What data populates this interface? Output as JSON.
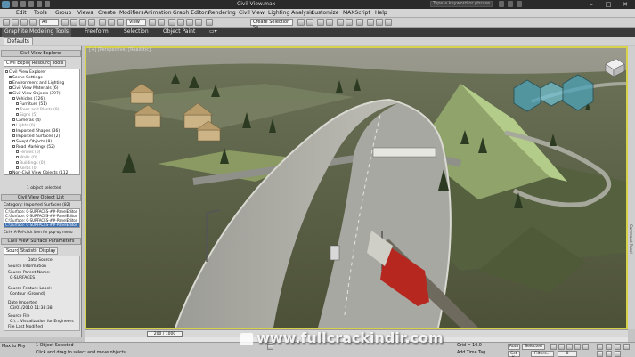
{
  "titlebar": {
    "title": "Civil-View.max",
    "search_placeholder": "Type a keyword or phrase",
    "min": "–",
    "max": "□",
    "close": "✕"
  },
  "menu": [
    "Edit",
    "Tools",
    "Group",
    "Views",
    "Create",
    "Modifiers",
    "Animation",
    "Graph Editors",
    "Rendering",
    "Civil View",
    "Lighting Analysis",
    "Customize",
    "MAXScript",
    "Help"
  ],
  "toolbar": {
    "selection_filter": "All",
    "view_dropdown": "View",
    "selection_set": "Create Selection Se"
  },
  "ribbon": {
    "tabs": [
      "Graphite Modeling Tools",
      "Freeform",
      "Selection",
      "Object Paint"
    ],
    "active_tab": "Graphite Modeling Tools",
    "sub_tab": "Defaults"
  },
  "leftpanel": {
    "explorer_header": "Civil View Explorer",
    "tabs": [
      "Civil Explorer",
      "Resources",
      "Tools"
    ],
    "tree": [
      {
        "label": "Civil View Explorer",
        "level": 0
      },
      {
        "label": "Scene Settings",
        "level": 1
      },
      {
        "label": "Environment and Lighting",
        "level": 1
      },
      {
        "label": "Civil View Materials (6)",
        "level": 1
      },
      {
        "label": "Civil View Objects (397)",
        "level": 1
      },
      {
        "label": "Vehicles (126)",
        "level": 2
      },
      {
        "label": "Furniture (51)",
        "level": 3
      },
      {
        "label": "Trees and Plants (8)",
        "level": 3
      },
      {
        "label": "Signs (5)",
        "level": 3
      },
      {
        "label": "Cameras (4)",
        "level": 2
      },
      {
        "label": "Lights (0)",
        "level": 2
      },
      {
        "label": "Imported Shapes (36)",
        "level": 2
      },
      {
        "label": "Imported Surfaces (2)",
        "level": 2
      },
      {
        "label": "Swept Objects (8)",
        "level": 2
      },
      {
        "label": "Road Markings (52)",
        "level": 2
      },
      {
        "label": "Fences (0)",
        "level": 3
      },
      {
        "label": "Walls (0)",
        "level": 3
      },
      {
        "label": "Buildings (0)",
        "level": 3
      },
      {
        "label": "Kerbs (0)",
        "level": 3
      },
      {
        "label": "Non-Civil View Objects (112)",
        "level": 1
      }
    ],
    "selection_info": "1 object selected",
    "object_list_header": "Civil View Object List",
    "category_label": "Category: Imported Surfaces (82)",
    "objects": [
      "C:\\Surface: C-SURFACES-##-PanelEditor",
      "C:\\Surface: C-SURFACES-##-PanelEditor",
      "C:\\Surface: C-SURFACES-##-PanelEditor",
      "C:\\Surface: C-SURFACES-##-PanelEditor"
    ],
    "list_hint": "Ctrl+ A-Ref-click item for pop-up menu",
    "params_header": "Civil View Surface Parameters",
    "param_tabs": [
      "Source",
      "Statistics",
      "Display"
    ],
    "params": [
      {
        "label": "Data Source",
        "value": ""
      },
      {
        "label": "Source Information",
        "value": ""
      },
      {
        "label": "Source Parent Name:",
        "value": "C-SURFACES"
      },
      {
        "label": "Source Feature Label:",
        "value": "Contour (Ground)"
      },
      {
        "label": "Date Imported",
        "value": "03/01/2010  11:38:38"
      },
      {
        "label": "Source File",
        "value": "C:\\...  Visualization for Engineers"
      },
      {
        "label": "File Last Modified",
        "value": ""
      }
    ]
  },
  "viewport": {
    "label": "[+] [Perspective] [Realistic]",
    "border_color": "#d8d14a"
  },
  "right_strip_label": "Command Panel",
  "timeline": {
    "frame_display": "200 / 1000"
  },
  "statusbar": {
    "max_label": "Max to Phy",
    "selection_text": "1 Object Selected",
    "prompt": "Click and drag to select and move objects",
    "grid": "Grid = 10.0",
    "add_time_tag": "Add Time Tag",
    "auto_key": "Auto",
    "set_key": "Set K.",
    "selected": "Selected",
    "filters": "Filters...",
    "frame": "0"
  },
  "watermark": "www.fullcrackindir.com"
}
